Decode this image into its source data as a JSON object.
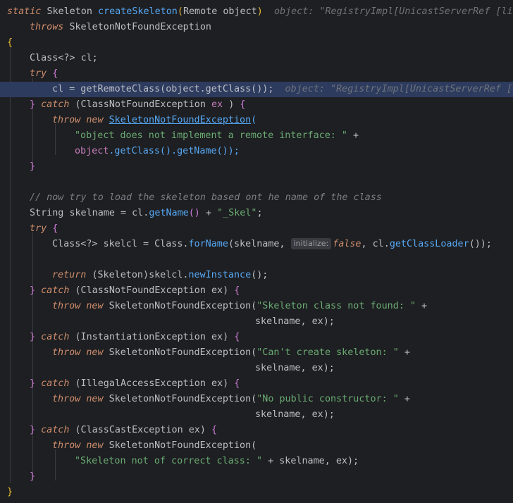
{
  "lines": {
    "l1": {
      "kw1": "static",
      "t1": "Skeleton",
      "m1": "createSkeleton",
      "p1": "(",
      "t2": "Remote",
      "v1": "object",
      "p2": ")",
      "hint": "object: \"RegistryImpl[UnicastServerRef [li"
    },
    "l2": {
      "kw1": "throws",
      "t1": "SkeletonNotFoundException"
    },
    "l3": {
      "b": "{"
    },
    "l4": {
      "t1": "Class<?>",
      "v1": "cl;"
    },
    "l5": {
      "kw1": "try",
      "b": "{"
    },
    "l6": {
      "v1": "cl = getRemoteClass(object.getClass());",
      "hint": "object: \"RegistryImpl[UnicastServerRef [li"
    },
    "l7": {
      "b1": "}",
      "kw1": "catch",
      "t1": "(ClassNotFoundException",
      "v1": "ex",
      "p1": ")",
      "b2": "{"
    },
    "l8": {
      "kw1": "throw",
      "kw2": "new",
      "t1": "SkeletonNotFoundException",
      "p1": "("
    },
    "l9": {
      "s1": "\"object does not implement a remote interface: \"",
      "p1": "+"
    },
    "l10": {
      "v1": "object",
      "m1": ".getClass().getName());"
    },
    "l11": {
      "b": "}"
    },
    "l13": {
      "c": "// now try to load the skeleton based ont he name of the class"
    },
    "l14": {
      "t1": "String",
      "v1": "skelname = cl.",
      "m1": "getName",
      "p1": "()",
      "p2": "+",
      "s1": "\"_Skel\"",
      "p3": ";"
    },
    "l15": {
      "kw1": "try",
      "b": "{"
    },
    "l16": {
      "t1": "Class<?>",
      "v1": "skelcl = Class.",
      "m1": "forName",
      "p1": "(skelname,",
      "inlay": "initialize:",
      "kw1": "false",
      "p2": ", cl.",
      "m2": "getClassLoader",
      "p3": "());"
    },
    "l18": {
      "kw1": "return",
      "t1": "(Skeleton)",
      "v1": "skelcl.",
      "m1": "newInstance",
      "p1": "();"
    },
    "l19": {
      "b1": "}",
      "kw1": "catch",
      "t1": "(ClassNotFoundException",
      "v1": "ex)",
      "b2": "{"
    },
    "l20": {
      "kw1": "throw",
      "kw2": "new",
      "t1": "SkeletonNotFoundException(",
      "s1": "\"Skeleton class not found: \"",
      "p1": "+"
    },
    "l21": {
      "v1": "skelname, ex);"
    },
    "l22": {
      "b1": "}",
      "kw1": "catch",
      "t1": "(InstantiationException",
      "v1": "ex)",
      "b2": "{"
    },
    "l23": {
      "kw1": "throw",
      "kw2": "new",
      "t1": "SkeletonNotFoundException(",
      "s1": "\"Can't create skeleton: \"",
      "p1": "+"
    },
    "l24": {
      "v1": "skelname, ex);"
    },
    "l25": {
      "b1": "}",
      "kw1": "catch",
      "t1": "(IllegalAccessException",
      "v1": "ex)",
      "b2": "{"
    },
    "l26": {
      "kw1": "throw",
      "kw2": "new",
      "t1": "SkeletonNotFoundException(",
      "s1": "\"No public constructor: \"",
      "p1": "+"
    },
    "l27": {
      "v1": "skelname, ex);"
    },
    "l28": {
      "b1": "}",
      "kw1": "catch",
      "t1": "(ClassCastException",
      "v1": "ex)",
      "b2": "{"
    },
    "l29": {
      "kw1": "throw",
      "kw2": "new",
      "t1": "SkeletonNotFoundException("
    },
    "l30": {
      "s1": "\"Skeleton not of correct class: \"",
      "p1": "+ skelname, ex);"
    },
    "l31": {
      "b": "}"
    },
    "l32": {
      "b": "}"
    }
  },
  "colors": {
    "background": "#1e1f22",
    "keyword": "#cf8e6d",
    "string": "#6aab73",
    "method": "#56a8f5",
    "comment": "#7a7e85",
    "highlight": "#2d3b5e"
  }
}
